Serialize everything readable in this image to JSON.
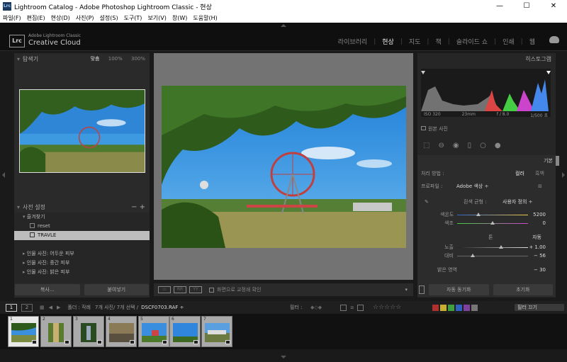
{
  "window": {
    "title": "Lightroom Catalog - Adobe Photoshop Lightroom Classic - 현상",
    "icon": "Lrc"
  },
  "window_controls": {
    "minimize": "—",
    "maximize": "☐",
    "close": "✕"
  },
  "menu": [
    "파일(F)",
    "편집(E)",
    "현상(D)",
    "사진(P)",
    "설정(S)",
    "도구(T)",
    "보기(V)",
    "창(W)",
    "도움말(H)"
  ],
  "identity": {
    "logo": "Lrc",
    "line1": "Adobe Lightroom Classic",
    "line2": "Creative Cloud"
  },
  "modules": [
    "라이브러리",
    "현상",
    "지도",
    "책",
    "슬라이드 쇼",
    "인쇄",
    "웹"
  ],
  "active_module": "현상",
  "navigator": {
    "title": "탐색기",
    "fit": "맞춤",
    "z1": "100%",
    "z2": "300%"
  },
  "presets": {
    "title": "사전 설정",
    "items": [
      {
        "label": "즐겨찾기",
        "kind": "group-open"
      },
      {
        "label": "reset",
        "kind": "preset"
      },
      {
        "label": "TRAVLE",
        "kind": "preset",
        "selected": true
      },
      {
        "label": "",
        "kind": "spacer"
      },
      {
        "label": "인물 사진: 어두운 피부",
        "kind": "group"
      },
      {
        "label": "인물 사진: 중간 피부",
        "kind": "group"
      },
      {
        "label": "인물 사진: 밝은 피부",
        "kind": "group"
      }
    ]
  },
  "left_buttons": {
    "copy": "복사...",
    "paste": "붙여넣기"
  },
  "toolbar": {
    "lock_label": "화면으로 교정쇄 확인"
  },
  "histogram": {
    "title": "히스토그램",
    "iso": "ISO 320",
    "focal": "23mm",
    "aperture": "f / 8.0",
    "shutter": "1/500 초"
  },
  "original": "원본 사진",
  "basic": {
    "title": "기본",
    "treatment_label": "처리 방법 :",
    "treatment_color": "컬러",
    "treatment_bw": "흑백",
    "profile_label": "프로파일 :",
    "profile_value": "Adobe 색상 ÷",
    "wb_label": "흰색 균형 :",
    "wb_value": "사용자 정의 ÷",
    "temp_label": "색온도",
    "temp_value": "5200",
    "temp_level": 0.3,
    "tint_label": "색조",
    "tint_value": "0",
    "tint_level": 0.5,
    "tone_label": "톤",
    "tone_auto": "자동",
    "exposure_label": "노출",
    "exposure_value": "+ 1.00",
    "exposure_level": 0.62,
    "contrast_label": "대비",
    "contrast_value": "− 56",
    "contrast_level": 0.22,
    "highlights_label": "밝은 영역",
    "highlights_value": "− 30"
  },
  "right_buttons": {
    "prev": "자동 동기화",
    "reset": "초기화"
  },
  "filmbar": {
    "page1": "1",
    "page2": "2",
    "source": "폴더 : 작례",
    "count": "7개 사진/ 7개 선택 /",
    "file": "DSCF0703.RAF ÷",
    "filter_label": "필터 :",
    "filter_value": "필터 끄기"
  },
  "thumbnails": [
    "1",
    "2",
    "3",
    "4",
    "5",
    "6",
    "7"
  ],
  "colors": {
    "swatches": [
      "#b03030",
      "#c8b030",
      "#40a040",
      "#3060c0",
      "#8040a0",
      "#777777"
    ]
  }
}
